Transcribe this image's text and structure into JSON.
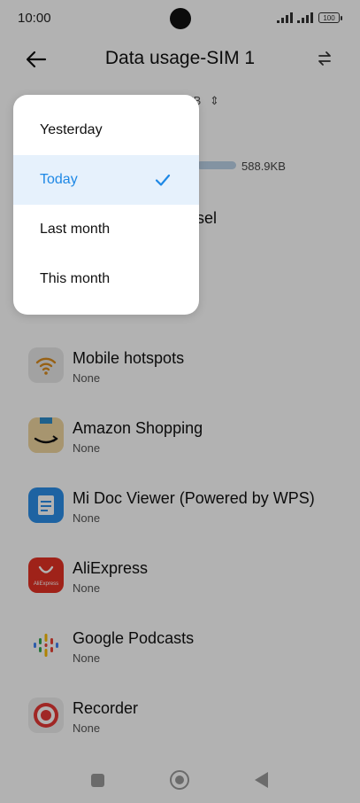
{
  "status_bar": {
    "time": "10:00",
    "battery": "100"
  },
  "header": {
    "title": "Data usage-SIM 1"
  },
  "background": {
    "usage_selector_tail": "KB",
    "usage_value": "588.9KB",
    "top_app_partial": "sel"
  },
  "apps": [
    {
      "name": "Mobile hotspots",
      "sub": "None",
      "icon": "wifi-hotspot-icon"
    },
    {
      "name": "Amazon Shopping",
      "sub": "None",
      "icon": "amazon-icon"
    },
    {
      "name": "Mi Doc Viewer (Powered by WPS)",
      "sub": "None",
      "icon": "doc-viewer-icon"
    },
    {
      "name": "AliExpress",
      "sub": "None",
      "icon": "aliexpress-icon",
      "icon_label": "AliExpress"
    },
    {
      "name": "Google Podcasts",
      "sub": "None",
      "icon": "podcasts-icon"
    },
    {
      "name": "Recorder",
      "sub": "None",
      "icon": "recorder-icon"
    }
  ],
  "dropdown": {
    "items": [
      "Yesterday",
      "Today",
      "Last month",
      "This month"
    ],
    "selected": "Today"
  },
  "colors": {
    "accent": "#1e88e5",
    "selected_bg": "#e6f1fc"
  }
}
